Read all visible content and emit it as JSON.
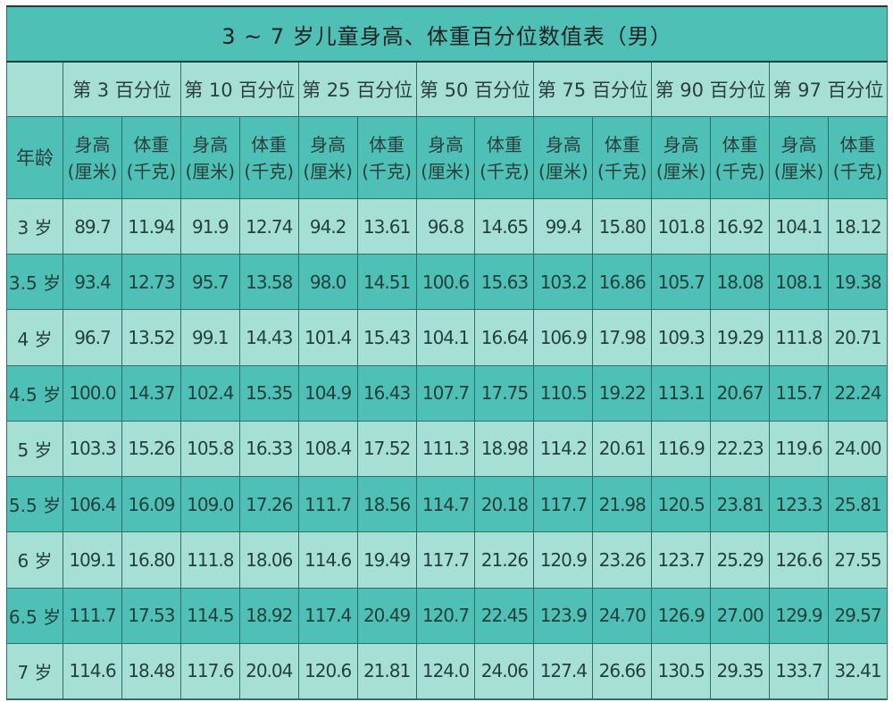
{
  "title": "3 ~ 7 岁儿童身高、体重百分位数值表（男）",
  "age_header": "年龄",
  "height_label": "身高",
  "height_unit": "(厘米)",
  "weight_label": "体重",
  "weight_unit": "(千克)",
  "percentiles": [
    "第 3 百分位",
    "第 10 百分位",
    "第 25 百分位",
    "第 50 百分位",
    "第 75 百分位",
    "第 90 百分位",
    "第 97 百分位"
  ],
  "colors": {
    "dark_teal": "#4ec0b5",
    "light_teal": "#a6e0d5",
    "border": "#2f6f69"
  },
  "rows": [
    {
      "age": "3 岁",
      "values": [
        "89.7",
        "11.94",
        "91.9",
        "12.74",
        "94.2",
        "13.61",
        "96.8",
        "14.65",
        "99.4",
        "15.80",
        "101.8",
        "16.92",
        "104.1",
        "18.12"
      ]
    },
    {
      "age": "3.5 岁",
      "values": [
        "93.4",
        "12.73",
        "95.7",
        "13.58",
        "98.0",
        "14.51",
        "100.6",
        "15.63",
        "103.2",
        "16.86",
        "105.7",
        "18.08",
        "108.1",
        "19.38"
      ]
    },
    {
      "age": "4 岁",
      "values": [
        "96.7",
        "13.52",
        "99.1",
        "14.43",
        "101.4",
        "15.43",
        "104.1",
        "16.64",
        "106.9",
        "17.98",
        "109.3",
        "19.29",
        "111.8",
        "20.71"
      ]
    },
    {
      "age": "4.5 岁",
      "values": [
        "100.0",
        "14.37",
        "102.4",
        "15.35",
        "104.9",
        "16.43",
        "107.7",
        "17.75",
        "110.5",
        "19.22",
        "113.1",
        "20.67",
        "115.7",
        "22.24"
      ]
    },
    {
      "age": "5 岁",
      "values": [
        "103.3",
        "15.26",
        "105.8",
        "16.33",
        "108.4",
        "17.52",
        "111.3",
        "18.98",
        "114.2",
        "20.61",
        "116.9",
        "22.23",
        "119.6",
        "24.00"
      ]
    },
    {
      "age": "5.5 岁",
      "values": [
        "106.4",
        "16.09",
        "109.0",
        "17.26",
        "111.7",
        "18.56",
        "114.7",
        "20.18",
        "117.7",
        "21.98",
        "120.5",
        "23.81",
        "123.3",
        "25.81"
      ]
    },
    {
      "age": "6 岁",
      "values": [
        "109.1",
        "16.80",
        "111.8",
        "18.06",
        "114.6",
        "19.49",
        "117.7",
        "21.26",
        "120.9",
        "23.26",
        "123.7",
        "25.29",
        "126.6",
        "27.55"
      ]
    },
    {
      "age": "6.5 岁",
      "values": [
        "111.7",
        "17.53",
        "114.5",
        "18.92",
        "117.4",
        "20.49",
        "120.7",
        "22.45",
        "123.9",
        "24.70",
        "126.9",
        "27.00",
        "129.9",
        "29.57"
      ]
    },
    {
      "age": "7 岁",
      "values": [
        "114.6",
        "18.48",
        "117.6",
        "20.04",
        "120.6",
        "21.81",
        "124.0",
        "24.06",
        "127.4",
        "26.66",
        "130.5",
        "29.35",
        "133.7",
        "32.41"
      ]
    }
  ]
}
